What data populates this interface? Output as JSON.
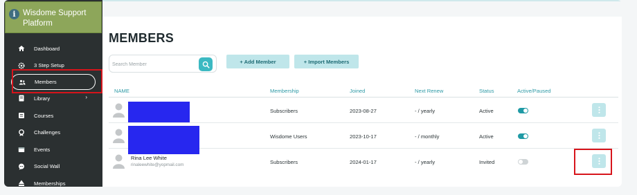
{
  "brand": {
    "title": "Wisdome Support Platform",
    "icon": "info-icon"
  },
  "sidebar": {
    "items": [
      {
        "label": "Dashboard",
        "icon": "home-icon"
      },
      {
        "label": "3 Step Setup",
        "icon": "gear-icon"
      },
      {
        "label": "Members",
        "icon": "users-icon",
        "active": true
      },
      {
        "label": "Library",
        "icon": "book-icon",
        "has_chevron": true
      },
      {
        "label": "Courses",
        "icon": "courses-icon"
      },
      {
        "label": "Challenges",
        "icon": "challenge-icon"
      },
      {
        "label": "Events",
        "icon": "events-icon"
      },
      {
        "label": "Social Wall",
        "icon": "chat-icon"
      },
      {
        "label": "Memberships",
        "icon": "membership-icon"
      }
    ]
  },
  "page": {
    "title": "MEMBERS"
  },
  "search": {
    "placeholder": "Search Member"
  },
  "actions": {
    "add_member": "+ Add Member",
    "import_members": "+ Import Members"
  },
  "table": {
    "headers": [
      "NAME",
      "Membership",
      "Joined",
      "Next Renew",
      "Status",
      "Active/Paused"
    ],
    "rows": [
      {
        "name": "",
        "email": "",
        "membership": "Subscribers",
        "joined": "2023-08-27",
        "next_renew": "- / yearly",
        "status": "Active",
        "active": true
      },
      {
        "name": "",
        "email": "",
        "membership": "Wisdome Users",
        "joined": "2023-10-17",
        "next_renew": "- / monthly",
        "status": "Active",
        "active": true
      },
      {
        "name": "Rina Lee White",
        "email": "rinaleewhite@yopmail.com",
        "membership": "Subscribers",
        "joined": "2024-01-17",
        "next_renew": "- / yearly",
        "status": "Invited",
        "active": false
      }
    ]
  },
  "colors": {
    "sidebar_bg": "#2b3031",
    "brand_bg": "#8da65a",
    "accent": "#3cb9c2",
    "highlight": "#d7141b",
    "redaction": "#2727ef"
  }
}
